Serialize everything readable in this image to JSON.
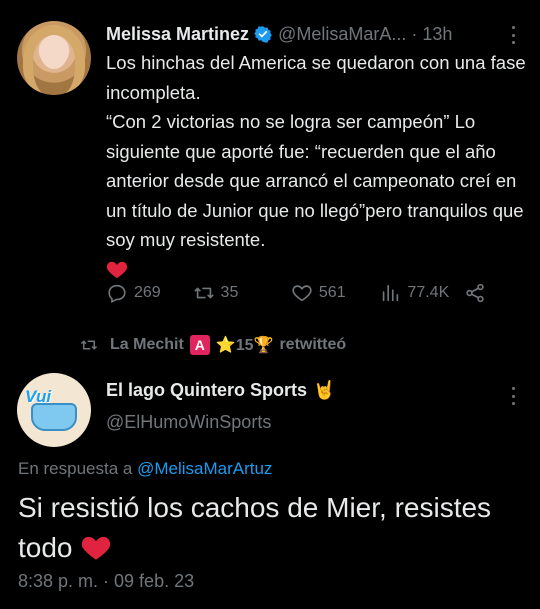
{
  "tweet1": {
    "author_name": "Melissa Martinez",
    "handle": "@MelisaMarA...",
    "time": "13h",
    "text_lines": [
      "Los hinchas del America se quedaron con una fase incompleta.",
      "“Con 2 victorias no se logra ser campeón” Lo siguiente que aporté fue: “recuerden que el año anterior desde que arrancó el campeonato creí en un título de Junior que no llegó”pero tranquilos que soy muy resistente."
    ],
    "actions": {
      "replies": "269",
      "retweets": "35",
      "likes": "561",
      "views": "77.4K"
    }
  },
  "retweet_context": {
    "user": "La Mechit",
    "badge": "A",
    "extra": "⭐15🏆",
    "verb": "retwitteó"
  },
  "tweet2": {
    "author_name": "El lago Quintero Sports",
    "name_emoji": "🤘",
    "handle": "@ElHumoWinSports",
    "avatar_text": "Vui",
    "reply_prefix": "En respuesta a",
    "reply_to": "@MelisaMarArtuz",
    "text": "Si resistió los cachos de Mier, resistes todo",
    "timestamp": "8:38 p. m. · 09 feb. 23"
  },
  "colors": {
    "background": "#000000",
    "text": "#e7e9ea",
    "muted": "#71767b",
    "link": "#1d9bf0",
    "heart": "#f91880"
  }
}
